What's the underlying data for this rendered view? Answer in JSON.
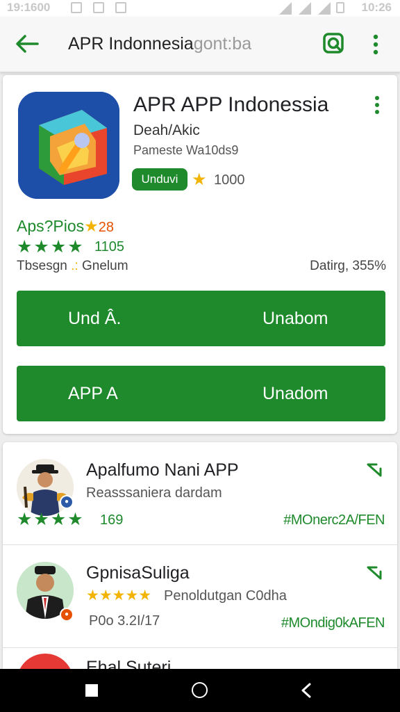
{
  "status_bar": {
    "time_left": "19:1600",
    "time_right": "10:26"
  },
  "app_bar": {
    "query": "APR Indonnesia",
    "query_hint": "gont:ba"
  },
  "app_card": {
    "title": "APR APP Indonessia",
    "developer": "Deah/Akic",
    "subtitle": "Pameste Wa10ds9",
    "install_label": "Unduvi",
    "rating_count": "1000"
  },
  "ratings": {
    "label": "Aps?Pios",
    "score": "28",
    "stars": "★★★★",
    "count": "1105",
    "meta_left": "Tbsesgn",
    "meta_left_tail": "Gnelum",
    "meta_right": "Datirg, 355%"
  },
  "buttons": [
    {
      "left": "Und Â.",
      "right": "Unabom"
    },
    {
      "left": "APP A",
      "right": "Unadom"
    }
  ],
  "list": [
    {
      "title": "Apalfumo Nani APP",
      "subtitle": "Reasssaniera dardam",
      "stars": "★★★★",
      "count": "169",
      "tag": "#MOnerc2A/FEN"
    },
    {
      "title": "GpnisaSuliga",
      "stars": "★★★★★",
      "subtitle": "Penoldutgan C0dha",
      "date": "P0o 3.2I/17",
      "tag": "#MOndig0kAFEN"
    },
    {
      "title": "Ehal Suteri"
    }
  ],
  "colors": {
    "accent_green": "#1e8a2c",
    "star_gold": "#f2b400",
    "nav_black": "#000000"
  }
}
